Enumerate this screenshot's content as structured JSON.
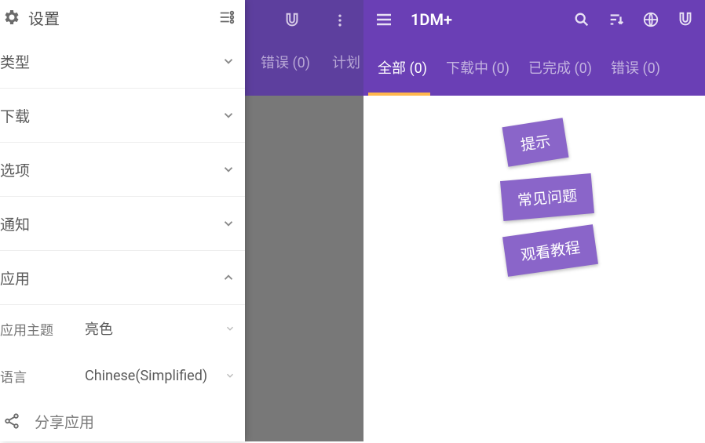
{
  "settings": {
    "title": "设置",
    "sections": {
      "type": "类型",
      "download": "下载",
      "options": "选项",
      "notifications": "通知",
      "app": "应用"
    },
    "app": {
      "theme_label": "应用主题",
      "theme_value": "亮色",
      "language_label": "语言",
      "language_value": "Chinese(Simplified)"
    },
    "share": "分享应用"
  },
  "middle": {
    "tab_errors": "错误 (0)",
    "tab_schedule": "计划"
  },
  "main": {
    "title": "1DM+",
    "tabs": {
      "all": "全部 (0)",
      "downloading": "下载中 (0)",
      "completed": "已完成 (0)",
      "errors": "错误 (0)"
    },
    "cards": {
      "tips": "提示",
      "faq": "常见问题",
      "tutorial": "观看教程"
    }
  }
}
